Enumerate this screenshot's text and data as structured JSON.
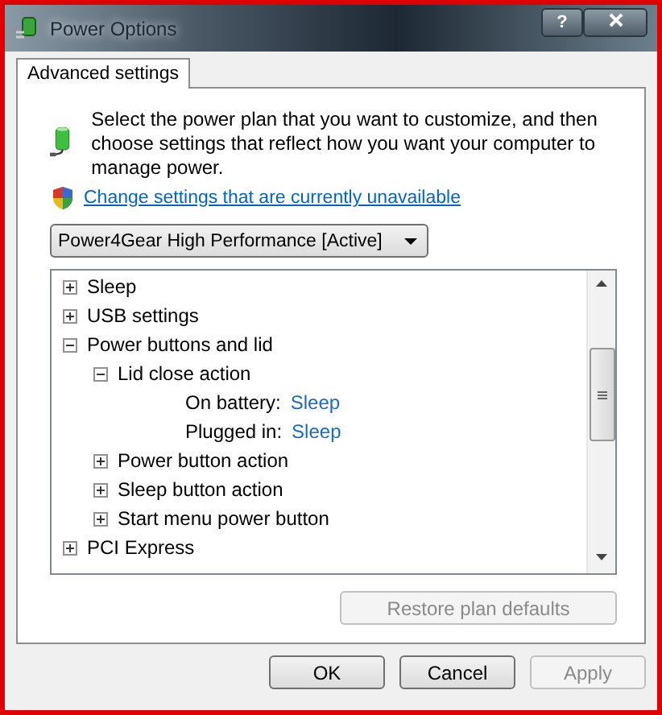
{
  "window": {
    "title": "Power Options",
    "help_button": "?"
  },
  "tabs": [
    {
      "label": "Advanced settings",
      "selected": true
    }
  ],
  "intro": "Select the power plan that you want to customize, and then choose settings that reflect how you want your computer to manage power.",
  "link": "Change settings that are currently unavailable",
  "plan_dropdown": {
    "value": "Power4Gear High Performance [Active]"
  },
  "tree": [
    {
      "kind": "group",
      "label": "Sleep",
      "expanded": false
    },
    {
      "kind": "group",
      "label": "USB settings",
      "expanded": false
    },
    {
      "kind": "group",
      "label": "Power buttons and lid",
      "expanded": true,
      "children": [
        {
          "kind": "group",
          "label": "Lid close action",
          "expanded": true,
          "children": [
            {
              "kind": "setting",
              "label": "On battery:",
              "value": "Sleep"
            },
            {
              "kind": "setting",
              "label": "Plugged in:",
              "value": "Sleep"
            }
          ]
        },
        {
          "kind": "group",
          "label": "Power button action",
          "expanded": false
        },
        {
          "kind": "group",
          "label": "Sleep button action",
          "expanded": false
        },
        {
          "kind": "group",
          "label": "Start menu power button",
          "expanded": false
        }
      ]
    },
    {
      "kind": "group",
      "label": "PCI Express",
      "expanded": false
    }
  ],
  "restore_button": {
    "label": "Restore plan defaults",
    "disabled": true
  },
  "buttons": [
    {
      "label": "OK",
      "disabled": false
    },
    {
      "label": "Cancel",
      "disabled": false
    },
    {
      "label": "Apply",
      "disabled": true
    }
  ]
}
